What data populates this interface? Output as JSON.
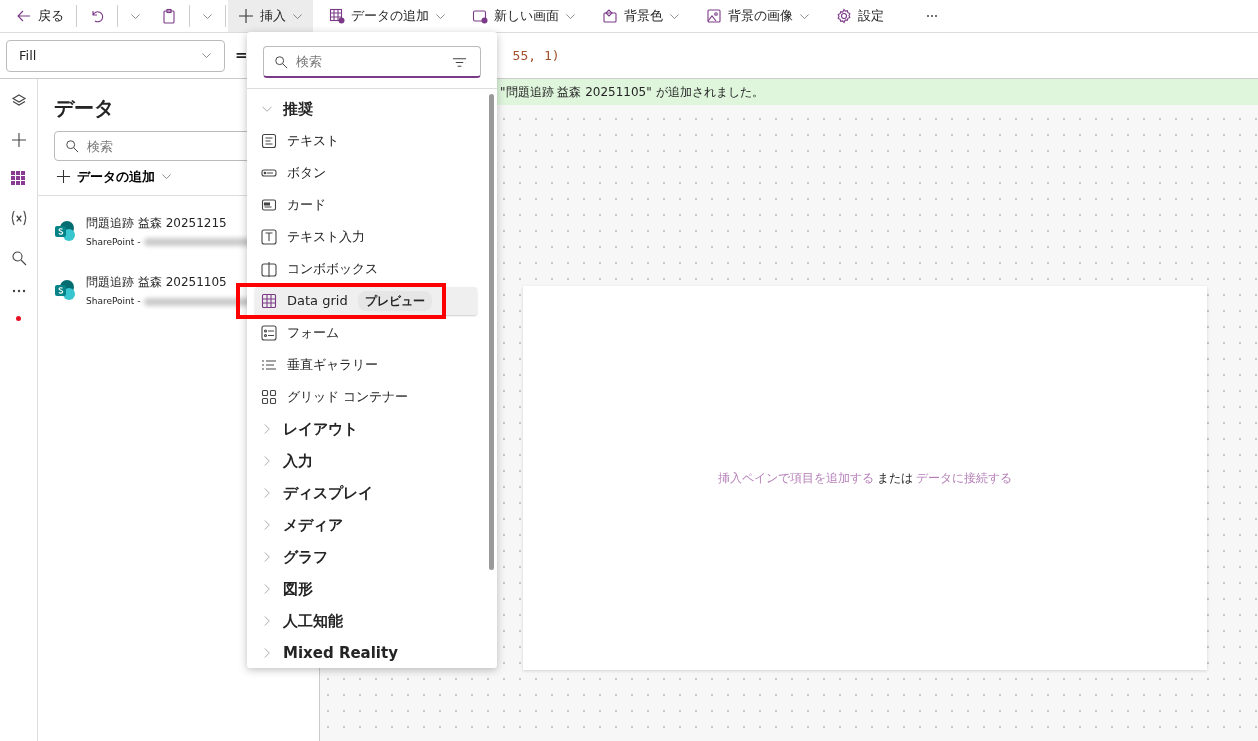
{
  "toolbar": {
    "back": "戻る",
    "items": [
      {
        "label": "挿入",
        "selected": true
      },
      {
        "label": "データの追加",
        "selected": false
      },
      {
        "label": "新しい画面",
        "selected": false
      },
      {
        "label": "背景色",
        "selected": false
      },
      {
        "label": "背景の画像",
        "selected": false
      }
    ],
    "settings": "設定"
  },
  "formula": {
    "property": "Fill",
    "equals": "=",
    "value": "55, 1)"
  },
  "banner": "\"問題追跡 益森 20251105\" が追加されました。",
  "rail": [
    {
      "selected": false
    },
    {
      "selected": false
    },
    {
      "selected": true
    },
    {
      "selected": false
    },
    {
      "selected": false
    },
    {
      "selected": false
    }
  ],
  "data_panel": {
    "title": "データ",
    "search_placeholder": "検索",
    "add": "データの追加",
    "sources": [
      {
        "name": "問題追跡 益森 20251215",
        "subtitle": "SharePoint -"
      },
      {
        "name": "問題追跡 益森 20251105",
        "subtitle": "SharePoint -"
      }
    ]
  },
  "insert_menu": {
    "search_placeholder": "検索",
    "entries": [
      {
        "kind": "section",
        "label": "推奨",
        "expanded": true
      },
      {
        "kind": "item",
        "label": "テキスト",
        "selected": false
      },
      {
        "kind": "item",
        "label": "ボタン",
        "selected": false
      },
      {
        "kind": "item",
        "label": "カード",
        "selected": false
      },
      {
        "kind": "item",
        "label": "テキスト入力",
        "selected": false
      },
      {
        "kind": "item",
        "label": "コンボボックス",
        "selected": false
      },
      {
        "kind": "item",
        "label": "Data grid",
        "badge": "プレビュー",
        "selected": true
      },
      {
        "kind": "item",
        "label": "フォーム",
        "selected": false
      },
      {
        "kind": "item",
        "label": "垂直ギャラリー",
        "selected": false
      },
      {
        "kind": "item",
        "label": "グリッド コンテナー",
        "selected": false
      },
      {
        "kind": "section",
        "label": "レイアウト",
        "expanded": false
      },
      {
        "kind": "section",
        "label": "入力",
        "expanded": false
      },
      {
        "kind": "section",
        "label": "ディスプレイ",
        "expanded": false
      },
      {
        "kind": "section",
        "label": "メディア",
        "expanded": false
      },
      {
        "kind": "section",
        "label": "グラフ",
        "expanded": false
      },
      {
        "kind": "section",
        "label": "図形",
        "expanded": false
      },
      {
        "kind": "section",
        "label": "人工知能",
        "expanded": false
      },
      {
        "kind": "section",
        "label": "Mixed Reality",
        "expanded": false
      }
    ]
  },
  "canvas": {
    "hint_parts": [
      {
        "kind": "link",
        "text": "挿入ペインで項目を追加する"
      },
      {
        "kind": "plain",
        "text": "または"
      },
      {
        "kind": "link",
        "text": "データに接続する"
      }
    ]
  }
}
